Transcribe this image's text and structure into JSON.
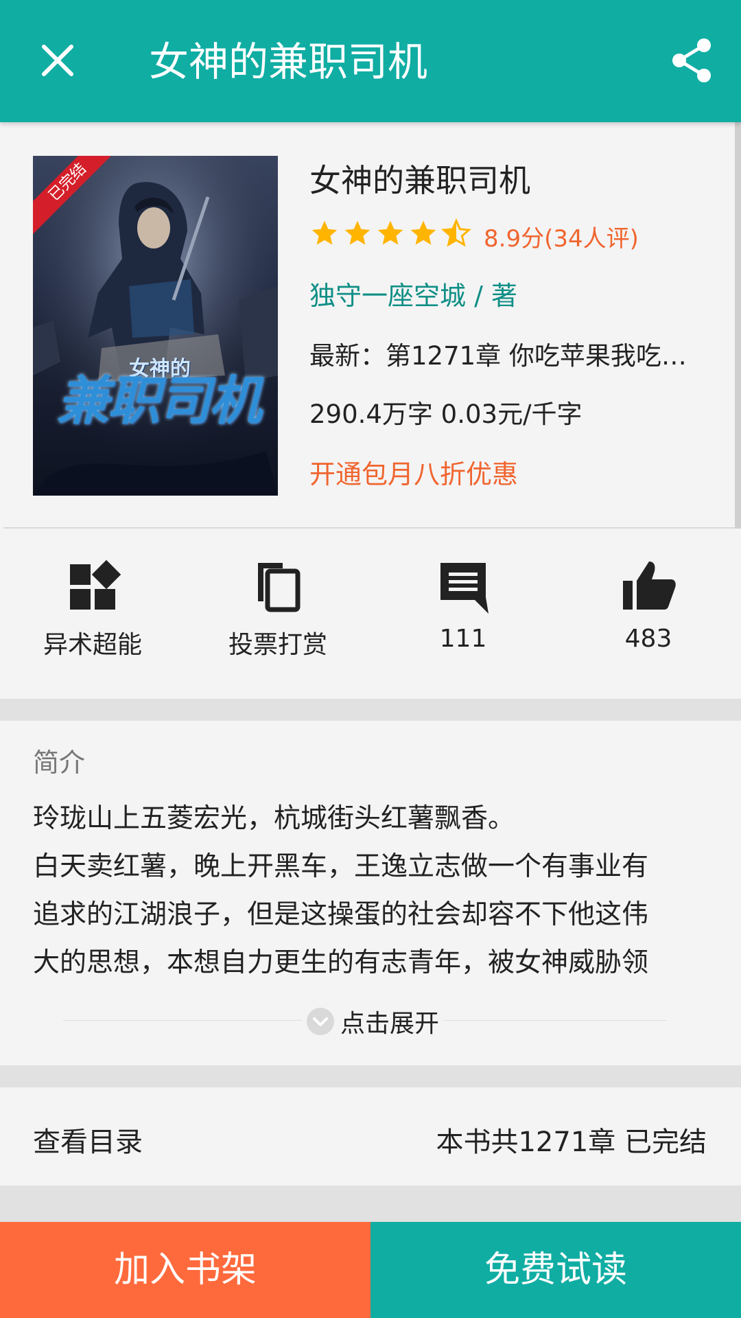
{
  "header": {
    "title": "女神的兼职司机",
    "close_icon": "close-icon",
    "share_icon": "share-icon",
    "background_color": "#10ada3"
  },
  "book": {
    "title": "女神的兼职司机",
    "cover_badge": "已完结",
    "cover_title": "兼职司机",
    "cover_subtitle": "女神的",
    "rating_stars": 4.5,
    "rating_max": 5,
    "rating_text": "8.9分(34人评)",
    "author_line": "独守一座空城 / 著",
    "latest_line": "最新：第1271章 你吃苹果我吃…",
    "wordcount_line": "290.4万字 0.03元/千字",
    "promo_line": "开通包月八折优惠"
  },
  "actions": [
    {
      "icon": "category-icon",
      "label": "异术超能"
    },
    {
      "icon": "copy-icon",
      "label": "投票打赏"
    },
    {
      "icon": "comment-icon",
      "label": "111"
    },
    {
      "icon": "thumbs-up-icon",
      "label": "483"
    }
  ],
  "intro": {
    "heading": "简介",
    "text_lines": [
      "玲珑山上五菱宏光，杭城街头红薯飘香。",
      "白天卖红薯，晚上开黑车，王逸立志做一个有事业有",
      "追求的江湖浪子，但是这操蛋的社会却容不下他这伟",
      "大的思想，本想自力更生的有志青年，被女神威胁领"
    ],
    "expand_label": "点击展开",
    "expand_icon": "chevron-down-circle-icon"
  },
  "catalog": {
    "left_label": "查看目录",
    "right_label": "本书共1271章 已完结"
  },
  "bottom": {
    "add_shelf_label": "加入书架",
    "free_read_label": "免费试读",
    "add_shelf_color": "#ff6a3d",
    "free_read_color": "#10ada3"
  },
  "colors": {
    "accent": "#10ada3",
    "orange": "#f0652f",
    "author": "#0f8f86",
    "star": "#ffb400"
  }
}
